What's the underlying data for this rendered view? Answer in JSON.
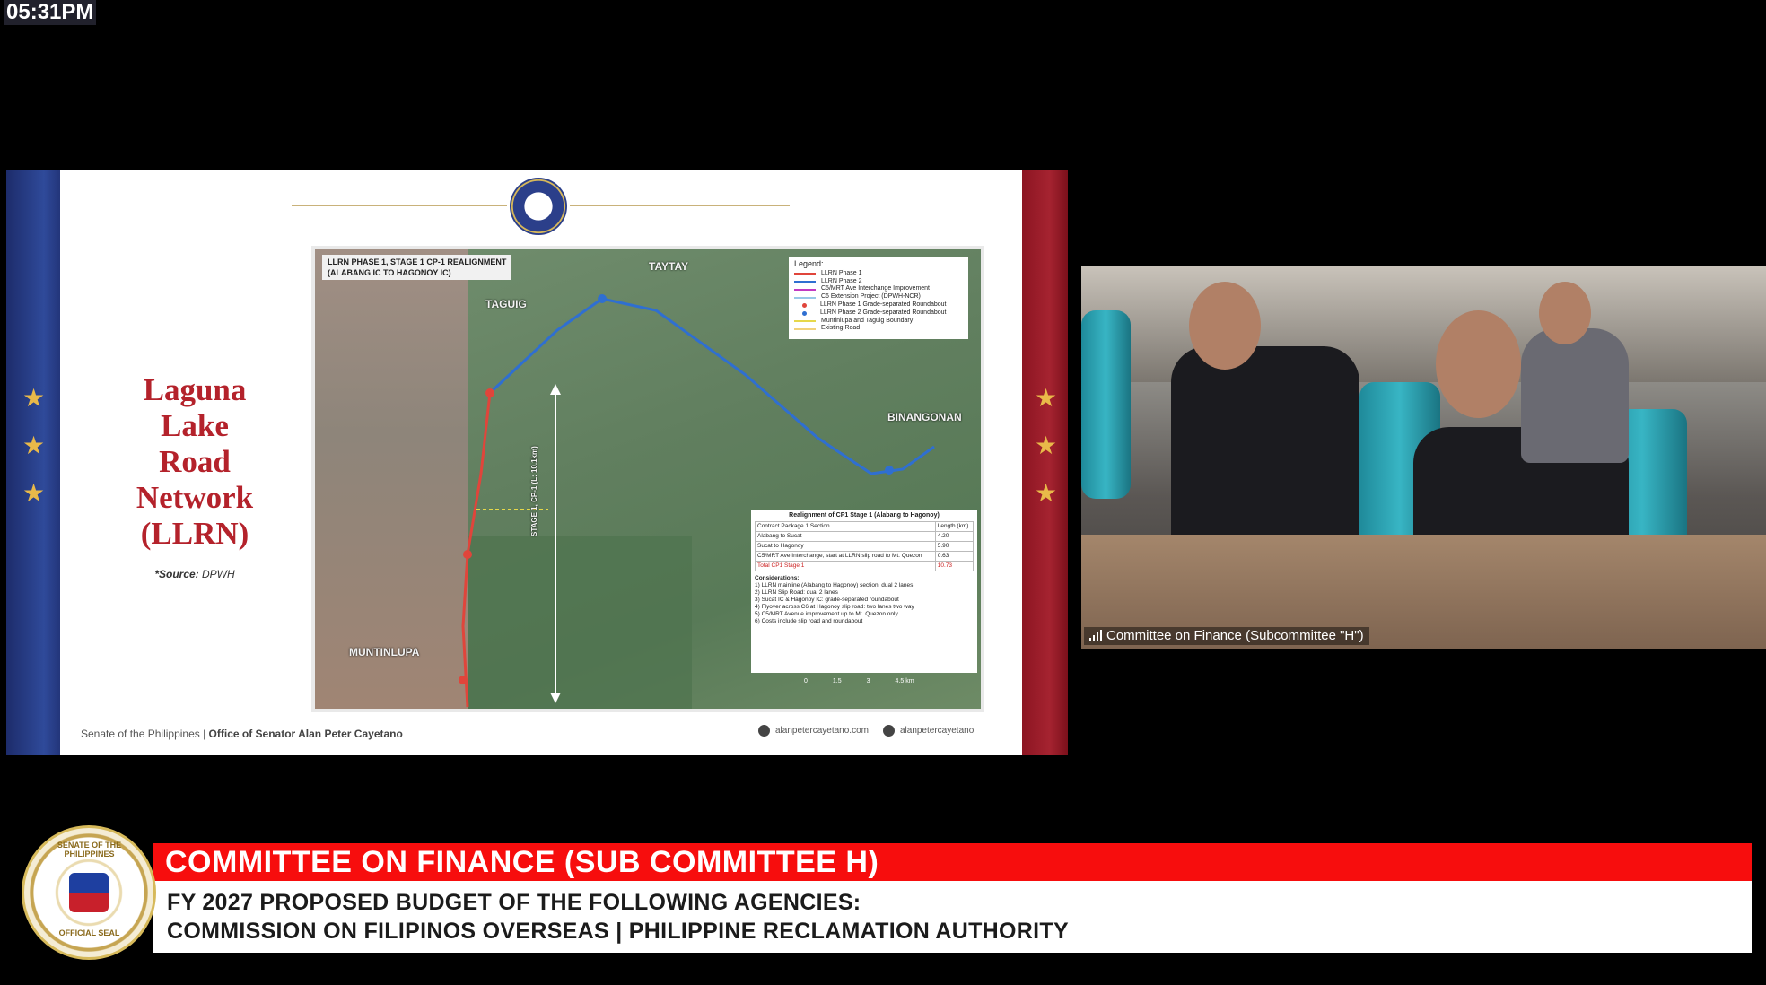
{
  "clock": "05:31PM",
  "slide": {
    "title": "Laguna\nLake\nRoad\nNetwork\n(LLRN)",
    "source_label": "*Source:",
    "source_value": "DPWH",
    "footer_org": "Senate of the Philippines | ",
    "footer_office": "Office of Senator Alan Peter Cayetano",
    "footer_website": "alanpetercayetano.com",
    "footer_social": "alanpetercayetano",
    "map": {
      "title": "LLRN PHASE 1, STAGE 1 CP-1 REALIGNMENT\n(ALABANG IC TO HAGONOY IC)",
      "places": [
        "TAGUIG",
        "TAYTAY",
        "BINANGONAN",
        "MUNTINLUPA"
      ],
      "stage_label": "STAGE 1, CP-1 (L: 10.1km)",
      "legend_title": "Legend:",
      "legend_items": [
        {
          "label": "LLRN Phase 1",
          "color": "#e0453b"
        },
        {
          "label": "LLRN Phase 2",
          "color": "#2f6fd1"
        },
        {
          "label": "C5/MRT Ave Interchange Improvement",
          "color": "#c23ac2"
        },
        {
          "label": "C6 Extension Project (DPWH-NCR)",
          "color": "#99c8e8"
        },
        {
          "label": "LLRN Phase 1 Grade-separated Roundabout",
          "color": "#e0453b"
        },
        {
          "label": "LLRN Phase 2 Grade-separated Roundabout",
          "color": "#2f6fd1"
        },
        {
          "label": "Muntinlupa and Taguig Boundary",
          "color": "#e6d84a"
        },
        {
          "label": "Existing Road",
          "color": "#f2d27a"
        }
      ],
      "table_title": "Realignment of CP1 Stage 1 (Alabang to Hagonoy)",
      "table_headers": [
        "Contract Package 1 Section",
        "Length (km)"
      ],
      "table_rows": [
        [
          "Alabang to Sucat",
          "4.20"
        ],
        [
          "Sucat to Hagonoy",
          "5.90"
        ],
        [
          "C5/MRT Ave Interchange, start at LLRN slip road to Mt. Quezon",
          "0.63"
        ],
        [
          "Total CP1 Stage 1",
          "10.73"
        ]
      ],
      "considerations_title": "Considerations:",
      "considerations": [
        "1) LLRN mainline (Alabang to Hagonoy) section: dual 2 lanes",
        "2) LLRN Slip Road: dual 2 lanes",
        "3) Sucat IC & Hagonoy IC: grade-separated roundabout",
        "4) Flyover across C6 at Hagonoy slip road: two lanes two way",
        "5) C5/MRT Avenue improvement up to Mt. Quezon only",
        "6) Costs include slip road and roundabout"
      ],
      "scale": [
        "0",
        "1.5",
        "3",
        "4.5 km"
      ]
    }
  },
  "video": {
    "label": "Committee on Finance (Subcommittee \"H\")"
  },
  "lower_third": {
    "seal_top": "SENATE OF THE PHILIPPINES",
    "seal_bottom": "OFFICIAL SEAL",
    "headline": "COMMITTEE ON FINANCE (SUB COMMITTEE H)",
    "line1": "FY 2027 PROPOSED BUDGET OF THE FOLLOWING AGENCIES:",
    "line2": "COMMISSION ON FILIPINOS OVERSEAS  |  PHILIPPINE RECLAMATION AUTHORITY"
  },
  "colors": {
    "headline_bar": "#f70d0d",
    "slide_title": "#b4222b",
    "phase1_route": "#e0453b",
    "phase2_route": "#2f6fd1"
  }
}
